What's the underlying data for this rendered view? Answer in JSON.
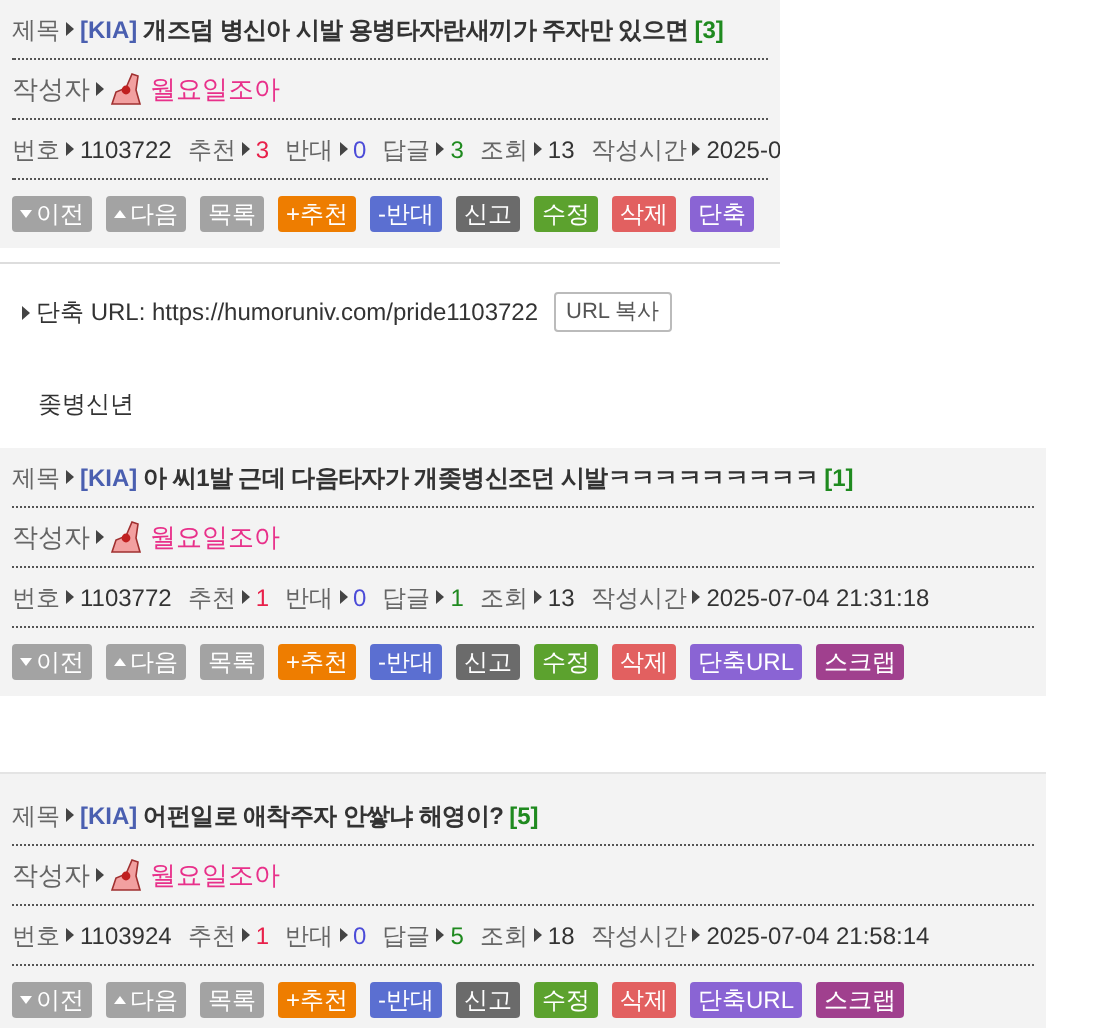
{
  "posts": [
    {
      "title_label": "제목",
      "category": "[KIA]",
      "title": "개즈덤 병신아 시발 용병타자란새끼가 주자만 있으면",
      "reply_count": "[3]",
      "author_label": "작성자",
      "author": "월요일조아",
      "meta": [
        {
          "kind": "plain",
          "label": "번호",
          "value": "1103722"
        },
        {
          "kind": "up",
          "label": "추천",
          "value": "3"
        },
        {
          "kind": "down",
          "label": "반대",
          "value": "0"
        },
        {
          "kind": "reply",
          "label": "답글",
          "value": "3"
        },
        {
          "kind": "plain",
          "label": "조회",
          "value": "13"
        },
        {
          "kind": "plain",
          "label": "작성시간",
          "value": "2025-0"
        }
      ],
      "buttons": [
        {
          "kind": "prev",
          "label": "이전"
        },
        {
          "kind": "next",
          "label": "다음"
        },
        {
          "kind": "list",
          "label": "목록"
        },
        {
          "kind": "up",
          "label": "+추천"
        },
        {
          "kind": "down",
          "label": "-반대"
        },
        {
          "kind": "report",
          "label": "신고"
        },
        {
          "kind": "edit",
          "label": "수정"
        },
        {
          "kind": "delete",
          "label": "삭제"
        },
        {
          "kind": "short",
          "label": "단축"
        }
      ],
      "short_url": {
        "label": "단축 URL: https://humoruniv.com/pride1103722",
        "button": "URL 복사"
      },
      "body": "좆병신년"
    },
    {
      "title_label": "제목",
      "category": "[KIA]",
      "title": "아 씨1발 근데 다음타자가 개좆병신조던 시발ㅋㅋㅋㅋㅋㅋㅋㅋㅋ",
      "reply_count": "[1]",
      "author_label": "작성자",
      "author": "월요일조아",
      "meta": [
        {
          "kind": "plain",
          "label": "번호",
          "value": "1103772"
        },
        {
          "kind": "up",
          "label": "추천",
          "value": "1"
        },
        {
          "kind": "down",
          "label": "반대",
          "value": "0"
        },
        {
          "kind": "reply",
          "label": "답글",
          "value": "1"
        },
        {
          "kind": "plain",
          "label": "조회",
          "value": "13"
        },
        {
          "kind": "plain",
          "label": "작성시간",
          "value": "2025-07-04 21:31:18"
        }
      ],
      "buttons": [
        {
          "kind": "prev",
          "label": "이전"
        },
        {
          "kind": "next",
          "label": "다음"
        },
        {
          "kind": "list",
          "label": "목록"
        },
        {
          "kind": "up",
          "label": "+추천"
        },
        {
          "kind": "down",
          "label": "-반대"
        },
        {
          "kind": "report",
          "label": "신고"
        },
        {
          "kind": "edit",
          "label": "수정"
        },
        {
          "kind": "delete",
          "label": "삭제"
        },
        {
          "kind": "short",
          "label": "단축URL"
        },
        {
          "kind": "scrap",
          "label": "스크랩"
        }
      ]
    },
    {
      "title_label": "제목",
      "category": "[KIA]",
      "title": "어펀일로 애착주자 안쌓냐 해영이?",
      "reply_count": "[5]",
      "author_label": "작성자",
      "author": "월요일조아",
      "meta": [
        {
          "kind": "plain",
          "label": "번호",
          "value": "1103924"
        },
        {
          "kind": "up",
          "label": "추천",
          "value": "1"
        },
        {
          "kind": "down",
          "label": "반대",
          "value": "0"
        },
        {
          "kind": "reply",
          "label": "답글",
          "value": "5"
        },
        {
          "kind": "plain",
          "label": "조회",
          "value": "18"
        },
        {
          "kind": "plain",
          "label": "작성시간",
          "value": "2025-07-04 21:58:14"
        }
      ],
      "buttons": [
        {
          "kind": "prev",
          "label": "이전"
        },
        {
          "kind": "next",
          "label": "다음"
        },
        {
          "kind": "list",
          "label": "목록"
        },
        {
          "kind": "up",
          "label": "+추천"
        },
        {
          "kind": "down",
          "label": "-반대"
        },
        {
          "kind": "report",
          "label": "신고"
        },
        {
          "kind": "edit",
          "label": "수정"
        },
        {
          "kind": "delete",
          "label": "삭제"
        },
        {
          "kind": "short",
          "label": "단축URL"
        },
        {
          "kind": "scrap",
          "label": "스크랩"
        }
      ]
    }
  ]
}
